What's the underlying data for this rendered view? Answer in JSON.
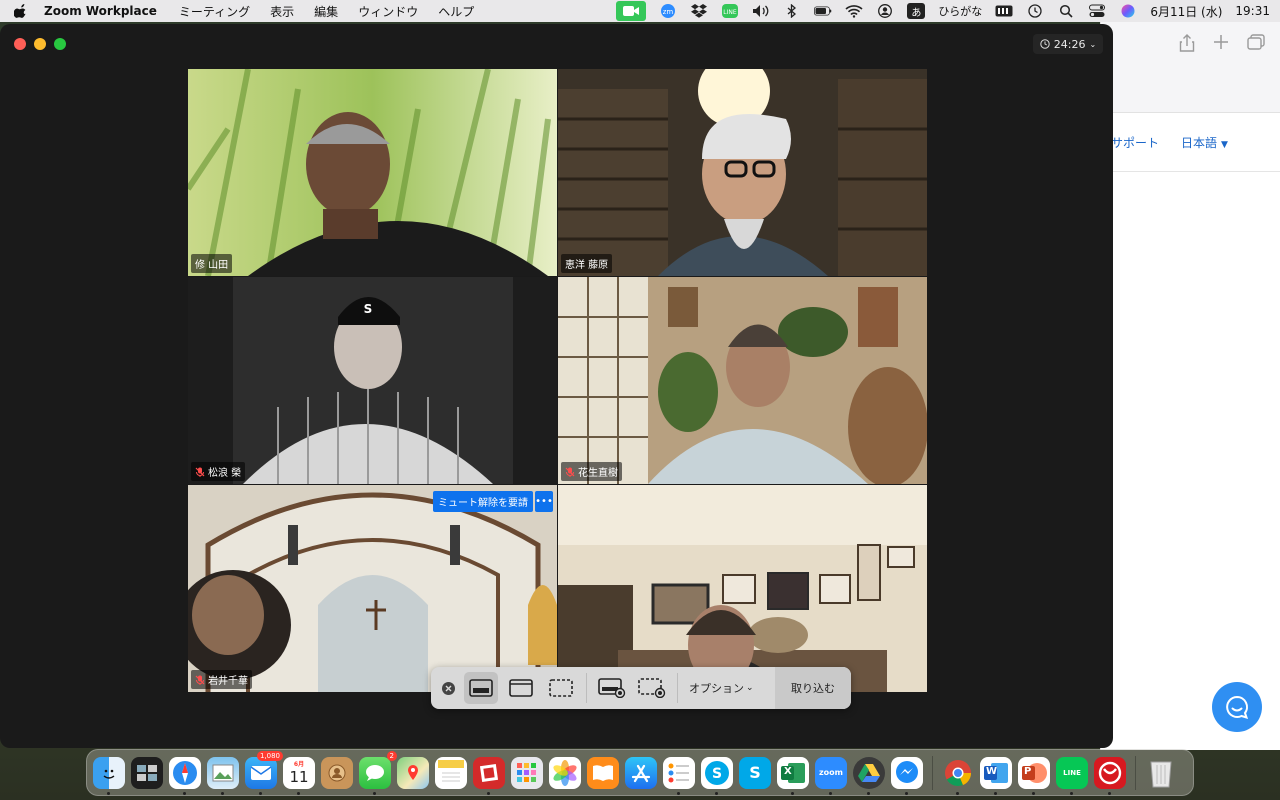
{
  "menubar": {
    "app_name": "Zoom Workplace",
    "menus": [
      "ミーティング",
      "表示",
      "編集",
      "ウィンドウ",
      "ヘルプ"
    ],
    "ime_label": "あ",
    "ime_mode": "ひらがな",
    "date": "6月11日 (水)",
    "time": "19:31",
    "status_icons": [
      "zoom-camera-icon",
      "zm-icon",
      "dropbox-icon",
      "line-icon",
      "volume-icon",
      "bluetooth-icon",
      "battery-icon",
      "wifi-icon",
      "user-icon",
      "ime-icon",
      "keyboard-icon",
      "time-machine-icon",
      "search-icon",
      "control-center-icon",
      "siri-icon"
    ]
  },
  "background_window": {
    "nav_support": "サポート",
    "nav_language": "日本語"
  },
  "meeting": {
    "elapsed": "24:26",
    "unmute_request_label": "ミュート解除を要請",
    "more_label": "•••",
    "participants": [
      {
        "name": "修 山田",
        "muted": false,
        "active": false
      },
      {
        "name": "恵洋 藤原",
        "muted": false,
        "active": false
      },
      {
        "name": "松浪 榮",
        "muted": true,
        "active": false
      },
      {
        "name": "花生直樹",
        "muted": true,
        "active": false
      },
      {
        "name": "岩井千華",
        "muted": true,
        "active": false
      },
      {
        "name": "",
        "muted": false,
        "active": true
      }
    ]
  },
  "share_toolbar": {
    "options_label": "オプション",
    "capture_label": "取り込む"
  },
  "dock": {
    "mail_badge": "1,080",
    "messages_badge": "2",
    "calendar_month": "6月",
    "calendar_day": "11",
    "zoom_label": "zoom",
    "skype_label": "S",
    "line_label": "LINE",
    "word_label": "W",
    "ppt_label": "P",
    "excel_label": "X"
  },
  "colors": {
    "active_speaker": "#29c140",
    "accent_blue": "#0e72ed",
    "menubar": "#e9e8ea"
  }
}
